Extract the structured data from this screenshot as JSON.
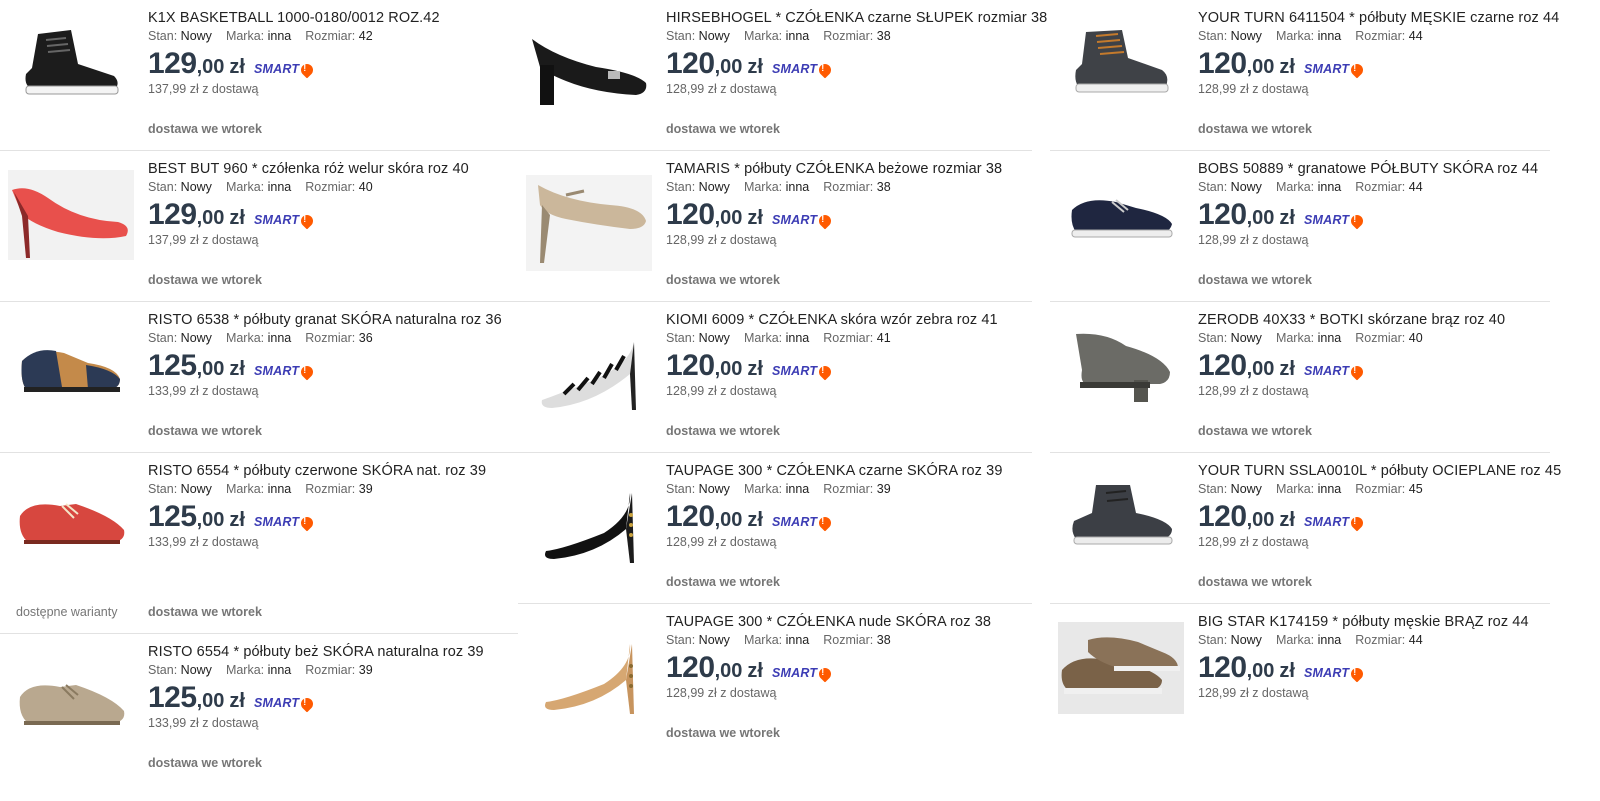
{
  "currency": "zł",
  "smart_label": "SMART",
  "meta_labels": {
    "state": "Stan:",
    "brand": "Marka:",
    "size": "Rozmiar:"
  },
  "columns": [
    [
      {
        "title": "K1X BASKETBALL 1000-0180/0012 ROZ.42",
        "state": "Nowy",
        "brand": "inna",
        "size": "42",
        "price_int": "129",
        "price_dec": ",00",
        "shipping": "137,99 zł z dostawą",
        "delivery": "dostawa we wtorek",
        "shoe": "black-sneaker-icon"
      },
      {
        "title": "BEST BUT 960 * czółenka róż welur skóra roz 40",
        "state": "Nowy",
        "brand": "inna",
        "size": "40",
        "price_int": "129",
        "price_dec": ",00",
        "shipping": "137,99 zł z dostawą",
        "delivery": "dostawa we wtorek",
        "shoe": "red-pump-icon"
      },
      {
        "title": "RISTO 6538 * półbuty granat SKÓRA naturalna roz 36",
        "state": "Nowy",
        "brand": "inna",
        "size": "36",
        "price_int": "125",
        "price_dec": ",00",
        "shipping": "133,99 zł z dostawą",
        "delivery": "dostawa we wtorek",
        "shoe": "navy-brown-oxford-icon"
      },
      {
        "title": "RISTO 6554 * półbuty czerwone SKÓRA nat. roz 39",
        "state": "Nowy",
        "brand": "inna",
        "size": "39",
        "price_int": "125",
        "price_dec": ",00",
        "shipping": "133,99 zł z dostawą",
        "delivery": "dostawa we wtorek",
        "variants": "dostępne warianty",
        "shoe": "red-oxford-icon"
      },
      {
        "title": "RISTO 6554 * półbuty beż SKÓRA naturalna roz 39",
        "state": "Nowy",
        "brand": "inna",
        "size": "39",
        "price_int": "125",
        "price_dec": ",00",
        "shipping": "133,99 zł z dostawą",
        "delivery": "dostawa we wtorek",
        "shoe": "beige-oxford-icon"
      }
    ],
    [
      {
        "title": "HIRSEBHOGEL * CZÓŁENKA czarne SŁUPEK rozmiar 38",
        "state": "Nowy",
        "brand": "inna",
        "size": "38",
        "price_int": "120",
        "price_dec": ",00",
        "shipping": "128,99 zł z dostawą",
        "delivery": "dostawa we wtorek",
        "shoe": "black-block-heel-icon"
      },
      {
        "title": "TAMARIS * półbuty CZÓŁENKA beżowe rozmiar 38",
        "state": "Nowy",
        "brand": "inna",
        "size": "38",
        "price_int": "120",
        "price_dec": ",00",
        "shipping": "128,99 zł z dostawą",
        "delivery": "dostawa we wtorek",
        "shoe": "beige-mary-jane-icon"
      },
      {
        "title": "KIOMI 6009 * CZÓŁENKA skóra wzór zebra roz 41",
        "state": "Nowy",
        "brand": "inna",
        "size": "41",
        "price_int": "120",
        "price_dec": ",00",
        "shipping": "128,99 zł z dostawą",
        "delivery": "dostawa we wtorek",
        "shoe": "zebra-pump-icon"
      },
      {
        "title": "TAUPAGE 300 * CZÓŁENKA czarne SKÓRA roz 39",
        "state": "Nowy",
        "brand": "inna",
        "size": "39",
        "price_int": "120",
        "price_dec": ",00",
        "shipping": "128,99 zł z dostawą",
        "delivery": "dostawa we wtorek",
        "shoe": "black-peep-toe-icon"
      },
      {
        "title": "TAUPAGE 300 * CZÓŁENKA nude SKÓRA roz 38",
        "state": "Nowy",
        "brand": "inna",
        "size": "38",
        "price_int": "120",
        "price_dec": ",00",
        "shipping": "128,99 zł z dostawą",
        "delivery": "dostawa we wtorek",
        "shoe": "nude-peep-toe-icon"
      }
    ],
    [
      {
        "title": "YOUR TURN 6411504 * półbuty MĘSKIE czarne roz 44",
        "state": "Nowy",
        "brand": "inna",
        "size": "44",
        "price_int": "120",
        "price_dec": ",00",
        "shipping": "128,99 zł z dostawą",
        "delivery": "dostawa we wtorek",
        "shoe": "grey-high-top-icon"
      },
      {
        "title": "BOBS 50889 * granatowe PÓŁBUTY SKÓRA roz 44",
        "state": "Nowy",
        "brand": "inna",
        "size": "44",
        "price_int": "120",
        "price_dec": ",00",
        "shipping": "128,99 zł z dostawą",
        "delivery": "dostawa we wtorek",
        "shoe": "navy-sneaker-icon"
      },
      {
        "title": "ZERODB 40X33 * BOTKI skórzane brąz roz 40",
        "state": "Nowy",
        "brand": "inna",
        "size": "40",
        "price_int": "120",
        "price_dec": ",00",
        "shipping": "128,99 zł z dostawą",
        "delivery": "dostawa we wtorek",
        "shoe": "grey-bootie-icon"
      },
      {
        "title": "YOUR TURN SSLA0010L * półbuty OCIEPLANE roz 45",
        "state": "Nowy",
        "brand": "inna",
        "size": "45",
        "price_int": "120",
        "price_dec": ",00",
        "shipping": "128,99 zł z dostawą",
        "delivery": "dostawa we wtorek",
        "shoe": "dark-chukka-icon"
      },
      {
        "title": "BIG STAR K174159 * półbuty męskie BRĄZ roz 44",
        "state": "Nowy",
        "brand": "inna",
        "size": "44",
        "price_int": "120",
        "price_dec": ",00",
        "shipping": "128,99 zł z dostawą",
        "delivery": "",
        "shoe": "brown-boat-shoe-icon"
      }
    ]
  ],
  "colors": {
    "price": "#2e3b4a",
    "smart": "#3c3cb4",
    "smart_pin": "#ff5a00",
    "muted": "#767676"
  }
}
